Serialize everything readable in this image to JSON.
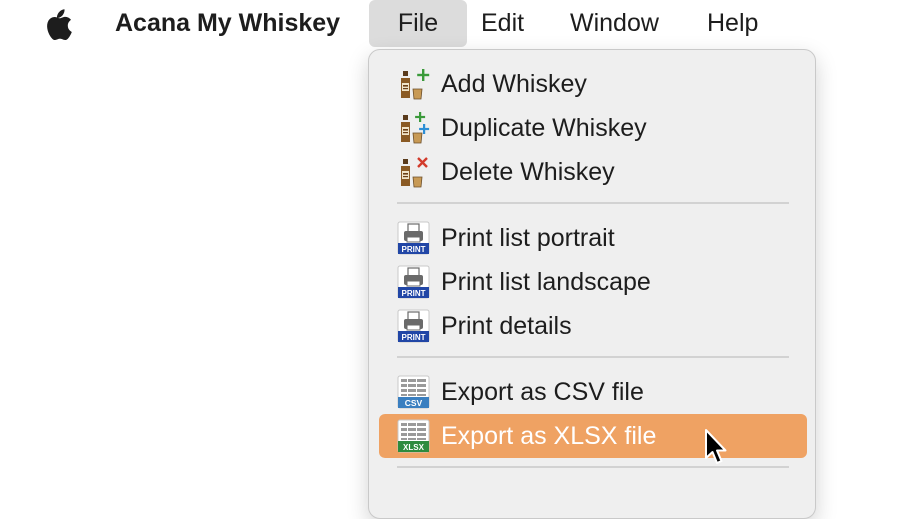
{
  "menubar": {
    "app_name": "Acana My Whiskey",
    "menus": [
      "File",
      "Edit",
      "Window",
      "Help"
    ],
    "active_menu": "File"
  },
  "file_menu": {
    "items": [
      {
        "label": "Add Whiskey",
        "icon": "whiskey-add-icon"
      },
      {
        "label": "Duplicate Whiskey",
        "icon": "whiskey-duplicate-icon"
      },
      {
        "label": "Delete Whiskey",
        "icon": "whiskey-delete-icon"
      },
      {
        "label": "Print list portrait",
        "icon": "print-icon"
      },
      {
        "label": "Print list landscape",
        "icon": "print-icon"
      },
      {
        "label": "Print details",
        "icon": "print-icon"
      },
      {
        "label": "Export as CSV file",
        "icon": "csv-icon"
      },
      {
        "label": "Export as XLSX file",
        "icon": "xlsx-icon",
        "highlighted": true
      }
    ],
    "icon_text": {
      "print": "PRINT",
      "csv": "CSV",
      "xlsx": "XLSX"
    }
  },
  "colors": {
    "highlight": "#efa263",
    "menu_background": "#efefef",
    "active_menu_background": "#dcdcdc",
    "print_badge": "#2146a6",
    "csv_badge": "#3a7fc0",
    "xlsx_badge": "#2e8b3e"
  }
}
